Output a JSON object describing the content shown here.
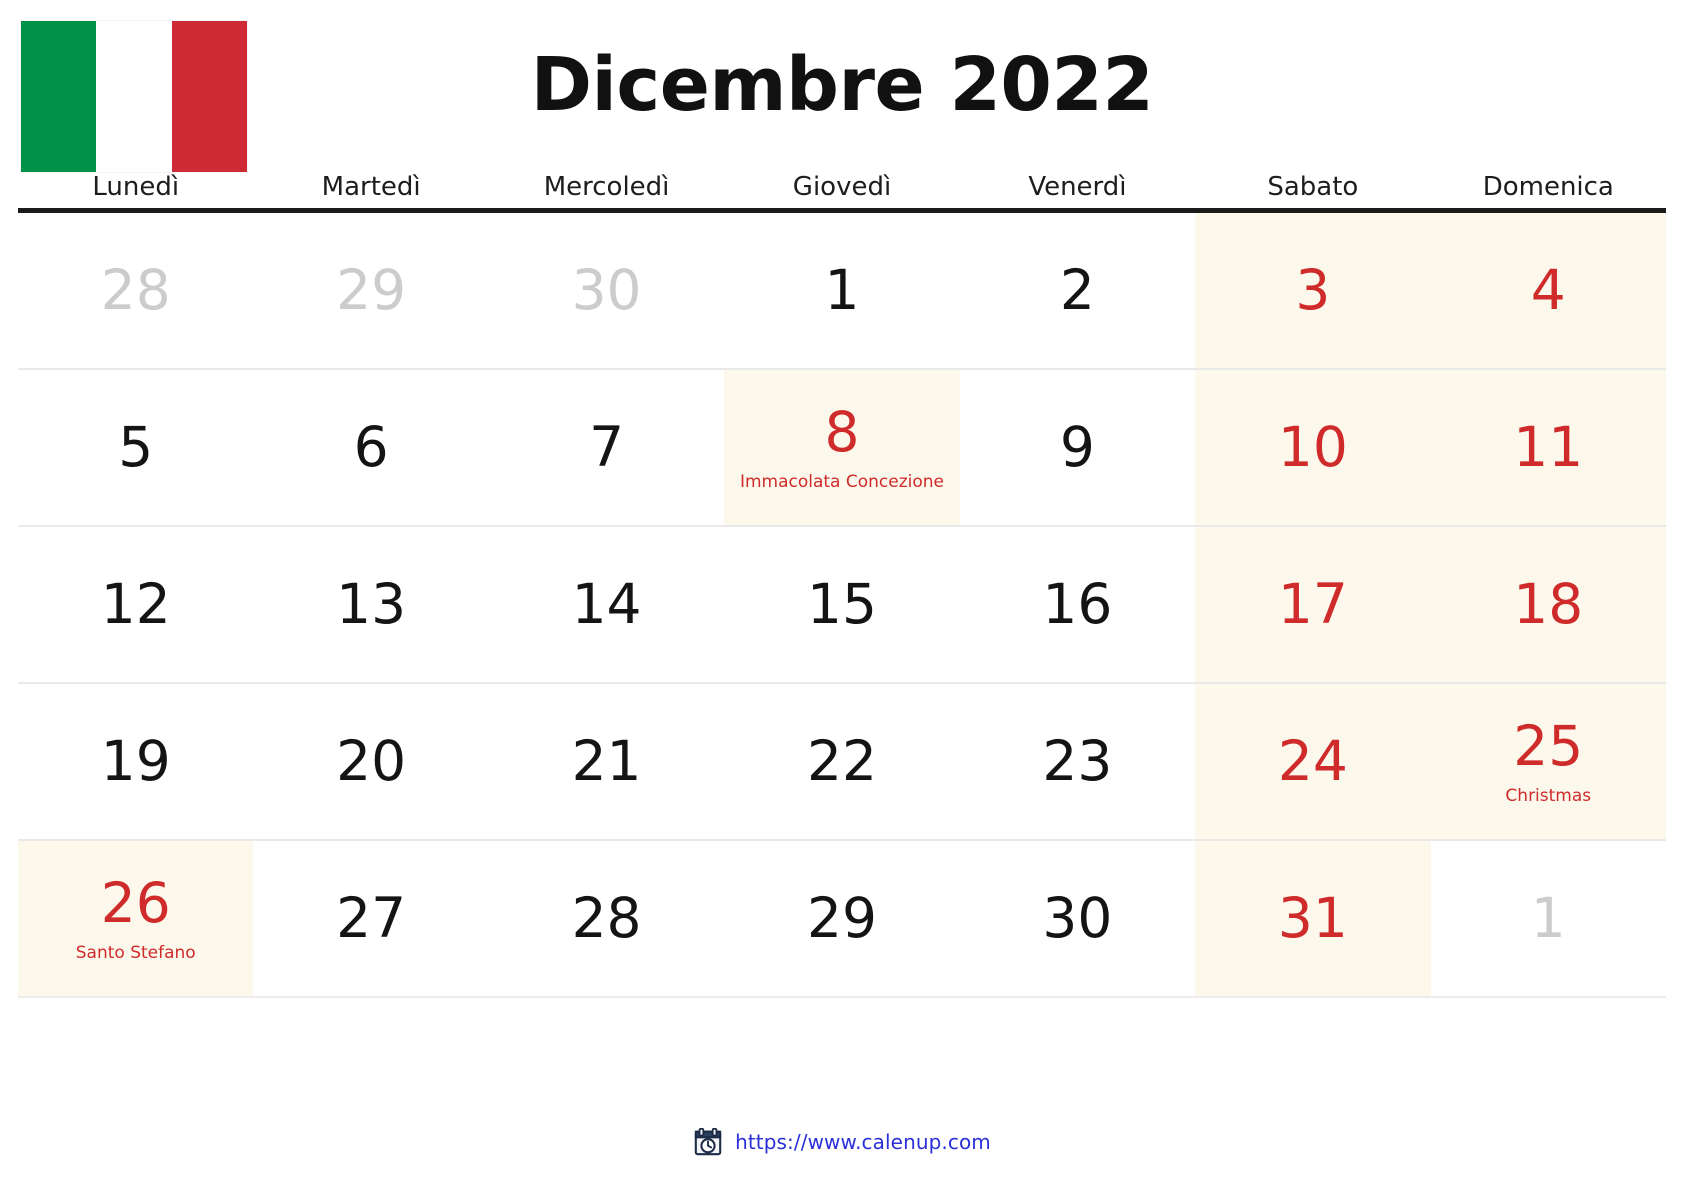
{
  "flag": {
    "name": "italy-flag",
    "bands": [
      "#009246",
      "#ffffff",
      "#ce2b37"
    ]
  },
  "title": "Dicembre 2022",
  "weekdays": [
    {
      "label": "Lunedì"
    },
    {
      "label": "Martedì"
    },
    {
      "label": "Mercoledì"
    },
    {
      "label": "Giovedì"
    },
    {
      "label": "Venerdì"
    },
    {
      "label": "Sabato"
    },
    {
      "label": "Domenica"
    }
  ],
  "colors": {
    "holiday_red": "#cf2b2b",
    "weekend_bg": "#fdf8ec",
    "muted_gray": "#cccccc",
    "text_black": "#141414",
    "link_blue": "#2b30d6",
    "header_rule": "#1b1b1b"
  },
  "weeks": [
    [
      {
        "num": "28",
        "event": "",
        "muted": true,
        "red": false,
        "shaded": false
      },
      {
        "num": "29",
        "event": "",
        "muted": true,
        "red": false,
        "shaded": false
      },
      {
        "num": "30",
        "event": "",
        "muted": true,
        "red": false,
        "shaded": false
      },
      {
        "num": "1",
        "event": "",
        "muted": false,
        "red": false,
        "shaded": false
      },
      {
        "num": "2",
        "event": "",
        "muted": false,
        "red": false,
        "shaded": false
      },
      {
        "num": "3",
        "event": "",
        "muted": false,
        "red": true,
        "shaded": true
      },
      {
        "num": "4",
        "event": "",
        "muted": false,
        "red": true,
        "shaded": true
      }
    ],
    [
      {
        "num": "5",
        "event": "",
        "muted": false,
        "red": false,
        "shaded": false
      },
      {
        "num": "6",
        "event": "",
        "muted": false,
        "red": false,
        "shaded": false
      },
      {
        "num": "7",
        "event": "",
        "muted": false,
        "red": false,
        "shaded": false
      },
      {
        "num": "8",
        "event": "Immacolata Concezione",
        "muted": false,
        "red": true,
        "shaded": true
      },
      {
        "num": "9",
        "event": "",
        "muted": false,
        "red": false,
        "shaded": false
      },
      {
        "num": "10",
        "event": "",
        "muted": false,
        "red": true,
        "shaded": true
      },
      {
        "num": "11",
        "event": "",
        "muted": false,
        "red": true,
        "shaded": true
      }
    ],
    [
      {
        "num": "12",
        "event": "",
        "muted": false,
        "red": false,
        "shaded": false
      },
      {
        "num": "13",
        "event": "",
        "muted": false,
        "red": false,
        "shaded": false
      },
      {
        "num": "14",
        "event": "",
        "muted": false,
        "red": false,
        "shaded": false
      },
      {
        "num": "15",
        "event": "",
        "muted": false,
        "red": false,
        "shaded": false
      },
      {
        "num": "16",
        "event": "",
        "muted": false,
        "red": false,
        "shaded": false
      },
      {
        "num": "17",
        "event": "",
        "muted": false,
        "red": true,
        "shaded": true
      },
      {
        "num": "18",
        "event": "",
        "muted": false,
        "red": true,
        "shaded": true
      }
    ],
    [
      {
        "num": "19",
        "event": "",
        "muted": false,
        "red": false,
        "shaded": false
      },
      {
        "num": "20",
        "event": "",
        "muted": false,
        "red": false,
        "shaded": false
      },
      {
        "num": "21",
        "event": "",
        "muted": false,
        "red": false,
        "shaded": false
      },
      {
        "num": "22",
        "event": "",
        "muted": false,
        "red": false,
        "shaded": false
      },
      {
        "num": "23",
        "event": "",
        "muted": false,
        "red": false,
        "shaded": false
      },
      {
        "num": "24",
        "event": "",
        "muted": false,
        "red": true,
        "shaded": true
      },
      {
        "num": "25",
        "event": "Christmas",
        "muted": false,
        "red": true,
        "shaded": true
      }
    ],
    [
      {
        "num": "26",
        "event": "Santo Stefano",
        "muted": false,
        "red": true,
        "shaded": true
      },
      {
        "num": "27",
        "event": "",
        "muted": false,
        "red": false,
        "shaded": false
      },
      {
        "num": "28",
        "event": "",
        "muted": false,
        "red": false,
        "shaded": false
      },
      {
        "num": "29",
        "event": "",
        "muted": false,
        "red": false,
        "shaded": false
      },
      {
        "num": "30",
        "event": "",
        "muted": false,
        "red": false,
        "shaded": false
      },
      {
        "num": "31",
        "event": "",
        "muted": false,
        "red": true,
        "shaded": true
      },
      {
        "num": "1",
        "event": "",
        "muted": true,
        "red": false,
        "shaded": false
      }
    ]
  ],
  "footer": {
    "icon": "calendar-clock-icon",
    "url": "https://www.calenup.com"
  }
}
